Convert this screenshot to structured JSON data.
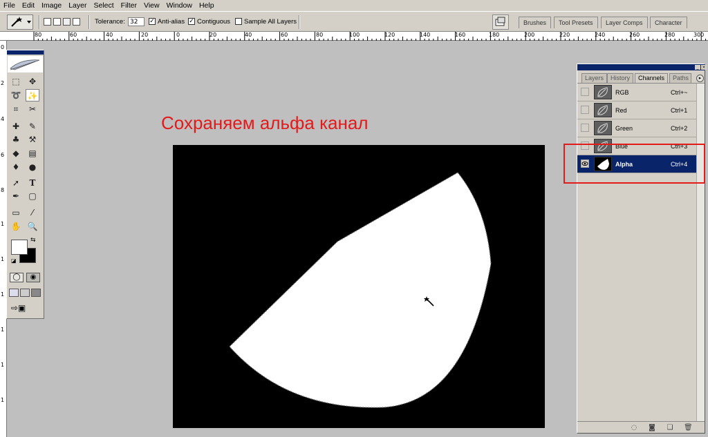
{
  "menu": [
    "File",
    "Edit",
    "Image",
    "Layer",
    "Select",
    "Filter",
    "View",
    "Window",
    "Help"
  ],
  "options": {
    "tolerance_label": "Tolerance:",
    "tolerance_value": "32",
    "antialias_label": "Anti-alias",
    "contiguous_label": "Contiguous",
    "sample_all_label": "Sample All Layers",
    "antialias_checked": "✓",
    "contiguous_checked": "✓"
  },
  "palette_tabs": [
    "Brushes",
    "Tool Presets",
    "Layer Comps",
    "Character"
  ],
  "ruler_top": [
    "80",
    "60",
    "40",
    "20",
    "0",
    "20",
    "40",
    "60",
    "80",
    "100",
    "120",
    "140",
    "160",
    "180",
    "200",
    "220",
    "240",
    "260",
    "280",
    "300"
  ],
  "ruler_left": [
    "0",
    "2",
    "4",
    "6",
    "8",
    "1",
    "1",
    "1",
    "1",
    "1",
    "1"
  ],
  "annotation": "Сохраняем альфа канал",
  "panel": {
    "tabs": [
      "Layers",
      "History",
      "Channels",
      "Paths"
    ],
    "channels": [
      {
        "name": "RGB",
        "shortcut": "Ctrl+~"
      },
      {
        "name": "Red",
        "shortcut": "Ctrl+1"
      },
      {
        "name": "Green",
        "shortcut": "Ctrl+2"
      },
      {
        "name": "Blue",
        "shortcut": "Ctrl+3"
      },
      {
        "name": "Alpha",
        "shortcut": "Ctrl+4"
      }
    ]
  },
  "colors": {
    "accent": "#0a246a",
    "annotation": "#e31a1a",
    "chrome": "#d4d0c8"
  },
  "icons": {
    "eye": "eye-icon",
    "wand": "magic-wand-icon",
    "cursor": "magic-wand-cursor-icon"
  }
}
